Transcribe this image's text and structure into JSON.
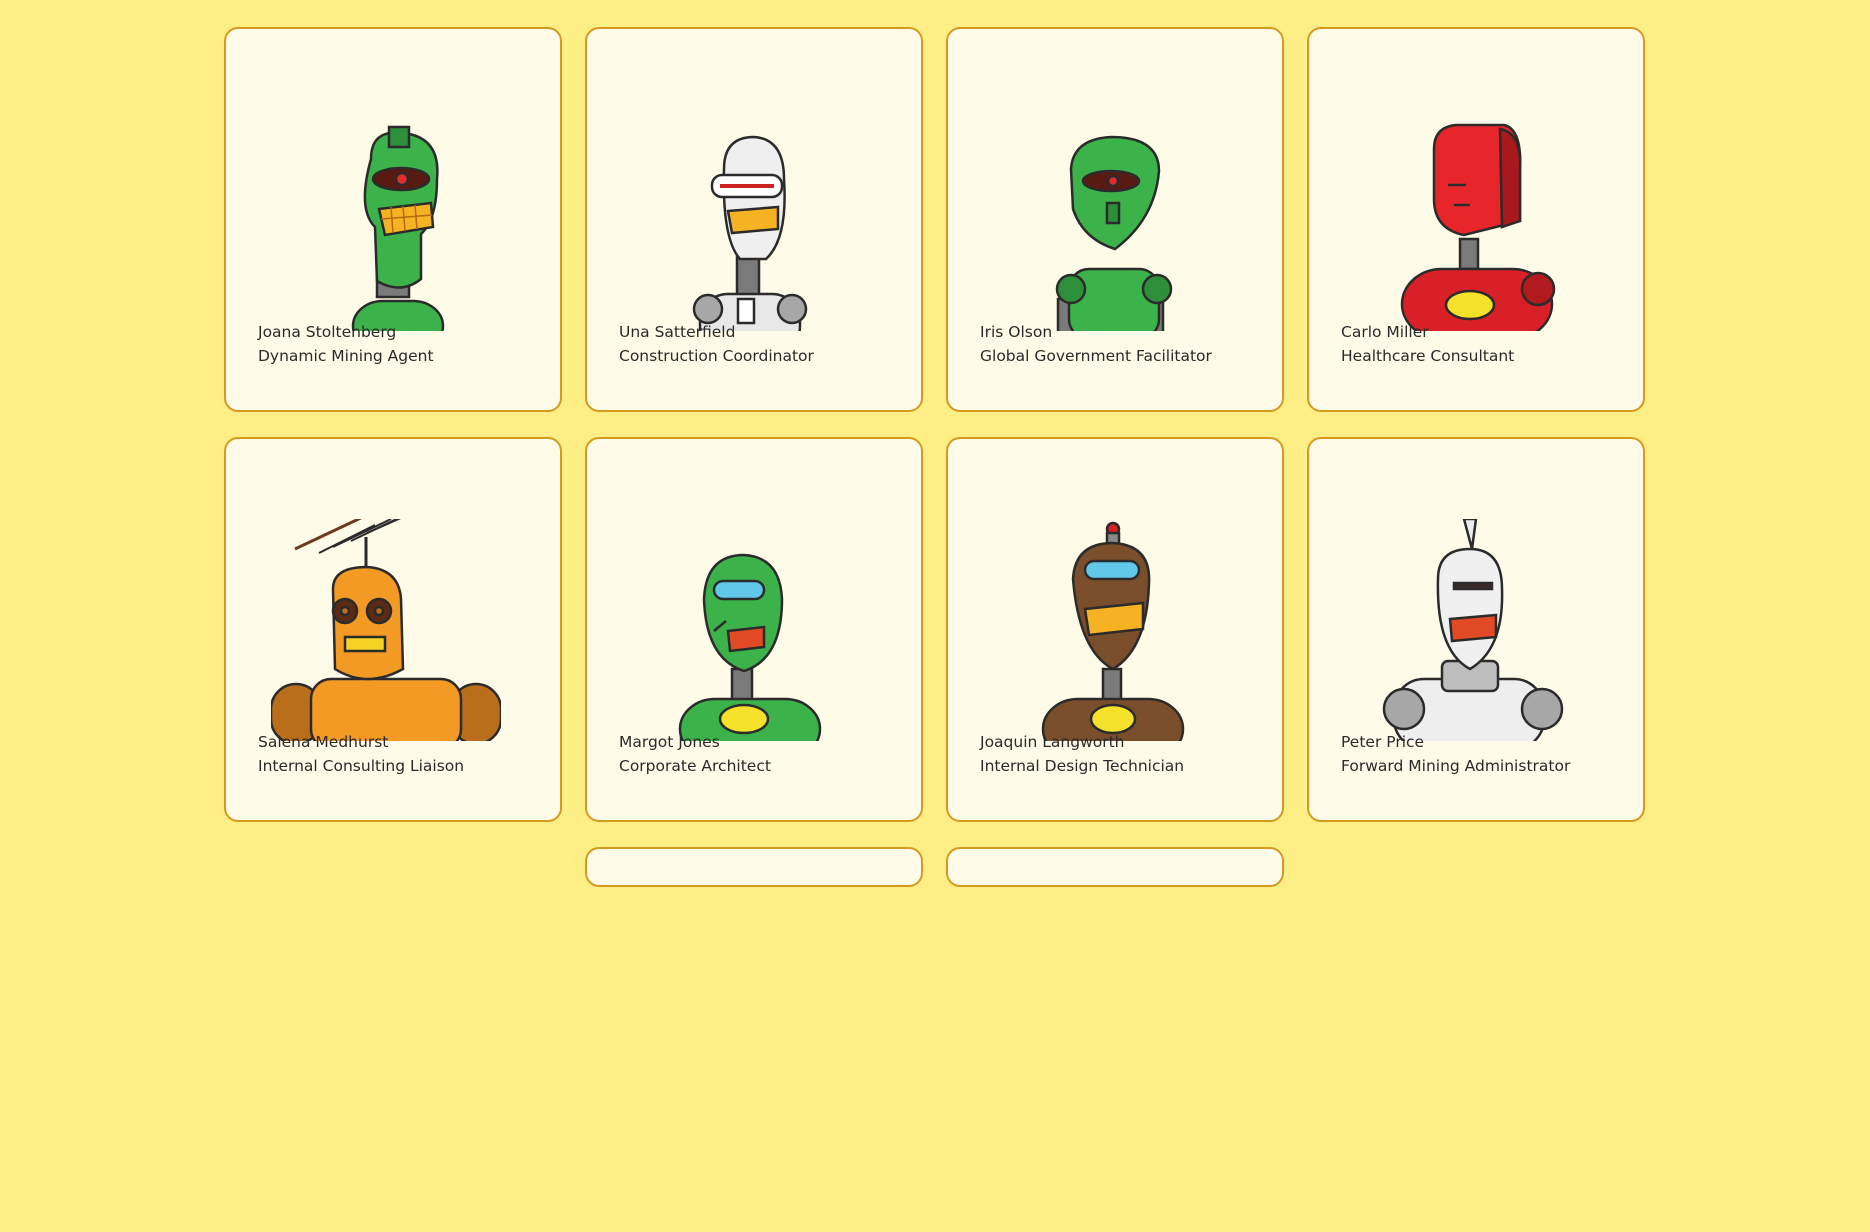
{
  "people": [
    {
      "name": "Joana Stoltenberg",
      "title": "Dynamic Mining Agent",
      "icon": "green-robot-avatar-icon"
    },
    {
      "name": "Una Satterfield",
      "title": "Construction Coordinator",
      "icon": "white-robot-avatar-icon"
    },
    {
      "name": "Iris Olson",
      "title": "Global Government Facilitator",
      "icon": "green-robot-avatar-icon"
    },
    {
      "name": "Carlo Miller",
      "title": "Healthcare Consultant",
      "icon": "red-robot-avatar-icon"
    },
    {
      "name": "Salena Medhurst",
      "title": "Internal Consulting Liaison",
      "icon": "orange-robot-avatar-icon"
    },
    {
      "name": "Margot Jones",
      "title": "Corporate Architect",
      "icon": "green-robot-avatar-icon"
    },
    {
      "name": "Joaquin Langworth",
      "title": "Internal Design Technician",
      "icon": "brown-robot-avatar-icon"
    },
    {
      "name": "Peter Price",
      "title": "Forward Mining Administrator",
      "icon": "white-robot-avatar-icon"
    }
  ],
  "colors": {
    "page_background": "#fdef85",
    "card_background": "#fefbe8",
    "card_border": "#d69a1f"
  }
}
